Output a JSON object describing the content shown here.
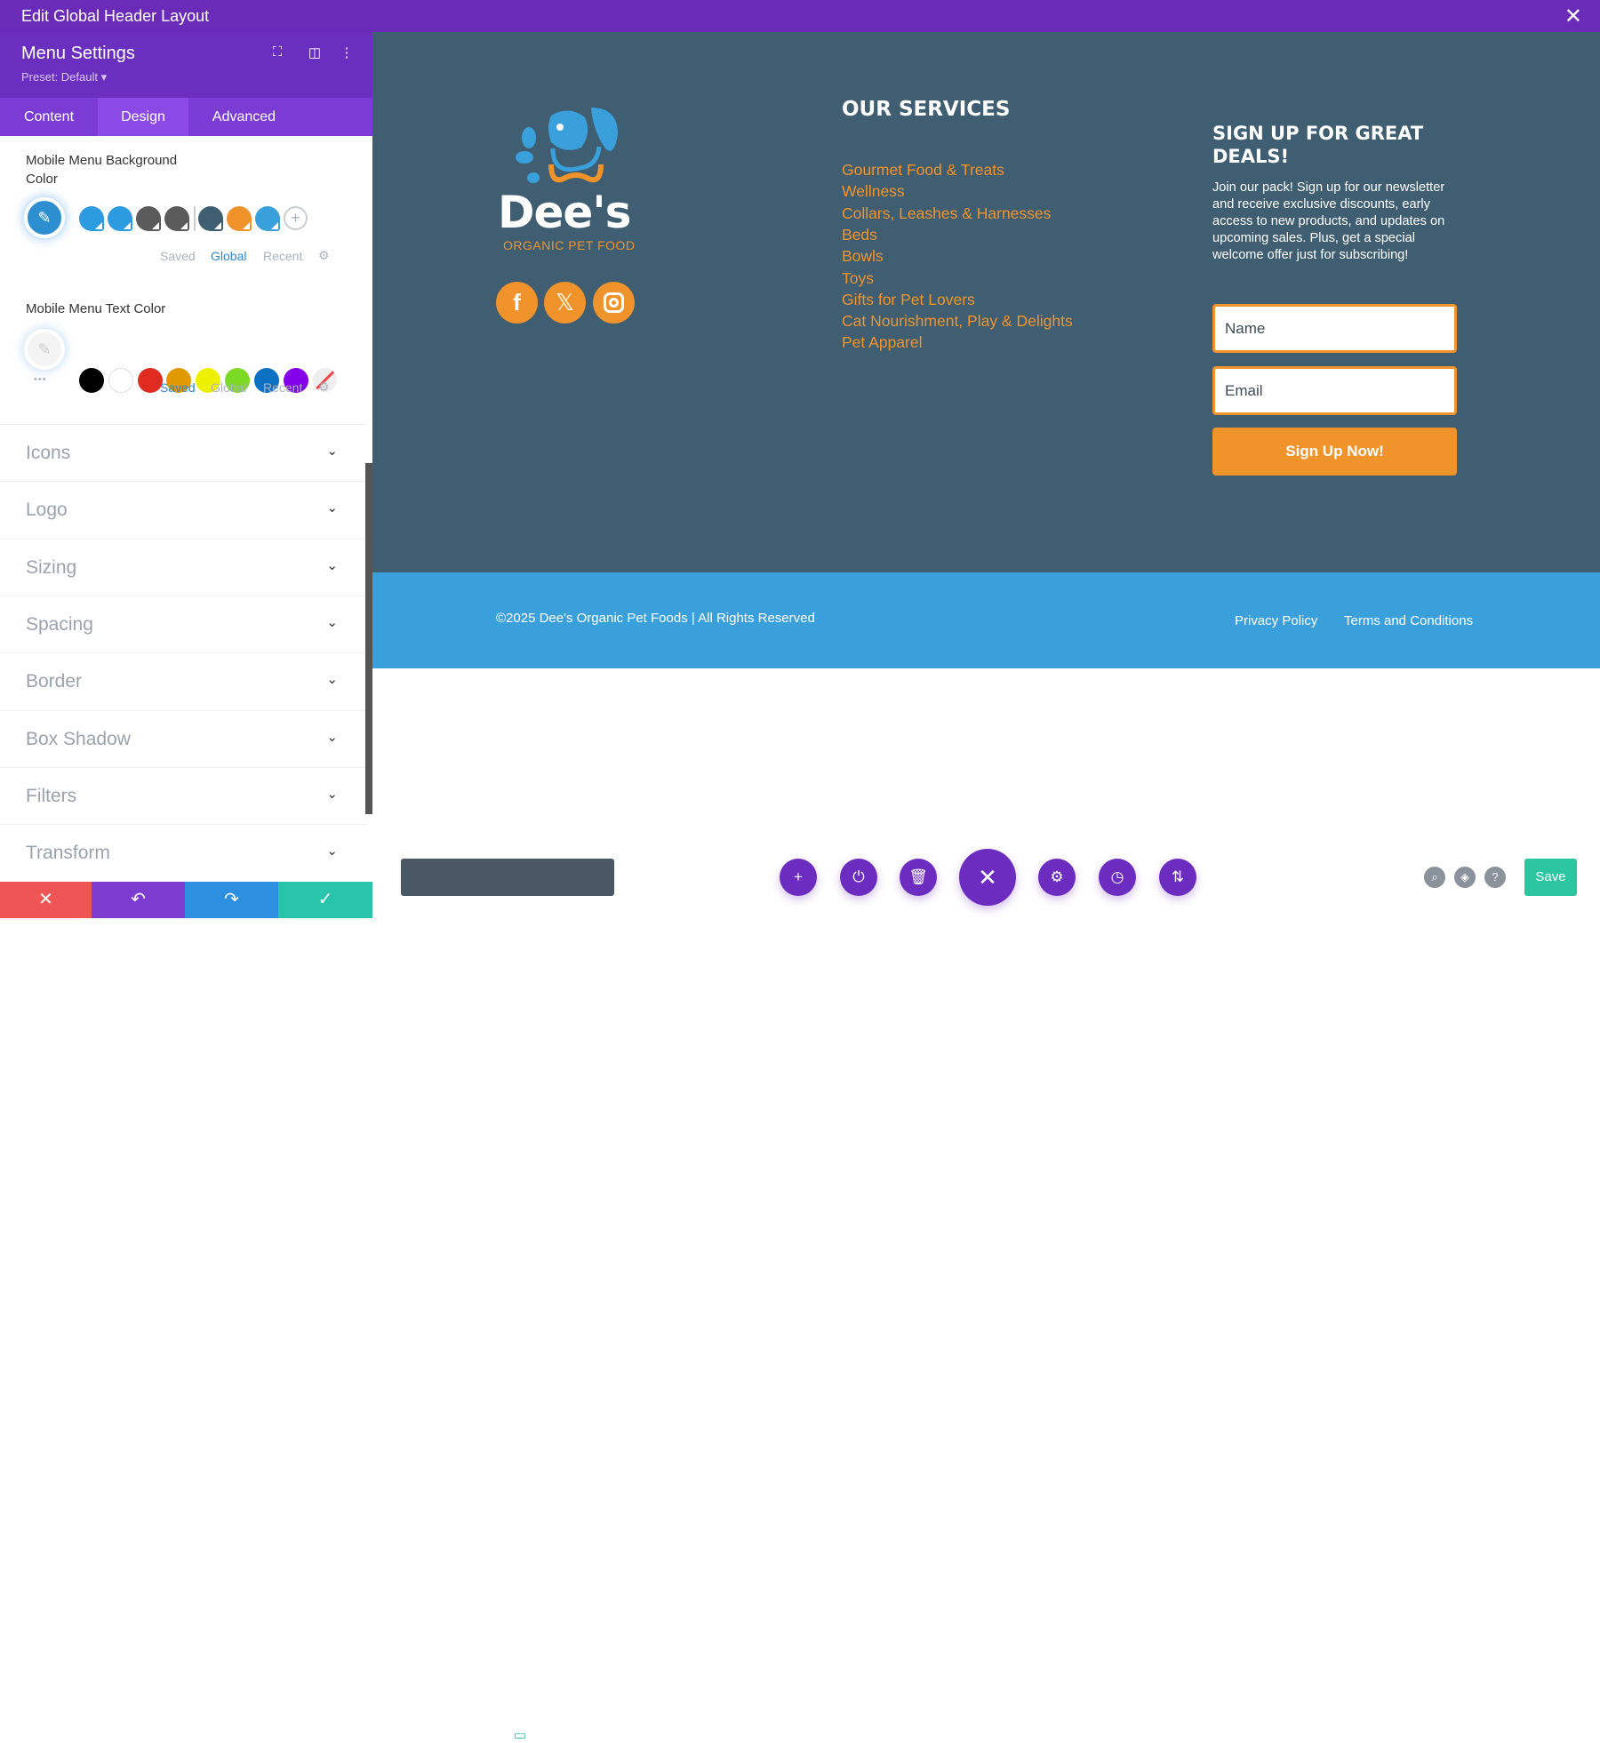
{
  "window": {
    "title": "Edit Global Header Layout",
    "close_icon": "close-icon"
  },
  "panel": {
    "title": "Menu Settings",
    "preset": "Preset: Default ▾",
    "tabs": [
      {
        "label": "Content"
      },
      {
        "label": "Design",
        "active": true
      },
      {
        "label": "Advanced"
      }
    ],
    "bg_color": {
      "label": "Mobile Menu Background Color",
      "swatches": [
        "#2d9be0",
        "#2d9be0",
        "#5b5b5b",
        "#5b5b5b",
        "#3f5e72",
        "#f0932b",
        "#3aa0dc"
      ],
      "sources": [
        "Saved",
        "Global",
        "Recent"
      ],
      "active_source": "Global"
    },
    "text_color": {
      "label": "Mobile Menu Text Color",
      "swatches": [
        "#000000",
        "#ffffff",
        "#e02b20",
        "#e09900",
        "#edf000",
        "#7cda24",
        "#0c71c3",
        "#8300e9"
      ],
      "sources": [
        "Saved",
        "Global",
        "Recent"
      ],
      "active_source": "Saved",
      "more": "•••"
    },
    "sections": [
      "Icons",
      "Logo",
      "Sizing",
      "Spacing",
      "Border",
      "Box Shadow",
      "Filters",
      "Transform"
    ],
    "bottom_buttons": {
      "discard": "✕",
      "undo": "↶",
      "redo": "↷",
      "confirm": "✓"
    }
  },
  "preview": {
    "logo": {
      "name": "Dee's",
      "tagline": "ORGANIC PET FOOD"
    },
    "social": [
      "facebook-icon",
      "x-icon",
      "instagram-icon"
    ],
    "services": {
      "heading": "our services",
      "links": [
        "Gourmet Food & Treats",
        "Wellness",
        "Collars, Leashes & Harnesses",
        "Beds",
        "Bowls",
        "Toys",
        "Gifts for Pet Lovers",
        "Cat Nourishment, Play & Delights",
        "Pet Apparel"
      ]
    },
    "signup": {
      "heading": "SIGN UP FOR GREAT DEALS!",
      "text": "Join our pack! Sign up for our newsletter and receive exclusive discounts, early access to new products, and updates on upcoming sales. Plus, get a special welcome offer just for subscribing!",
      "name_placeholder": "Name",
      "email_placeholder": "Email",
      "button": "Sign Up Now!"
    },
    "copyright": "©2025 Dee's Organic Pet Foods | All Rights Reserved",
    "footer_links": [
      "Privacy Policy",
      "Terms and Conditions"
    ]
  },
  "toolbar": {
    "save": "Save"
  },
  "colors": {
    "purple": "#6a2cb8",
    "orange": "#f0932b",
    "slate": "#3f5e72",
    "blue": "#3aa0dc",
    "green": "#2bc6a0"
  }
}
